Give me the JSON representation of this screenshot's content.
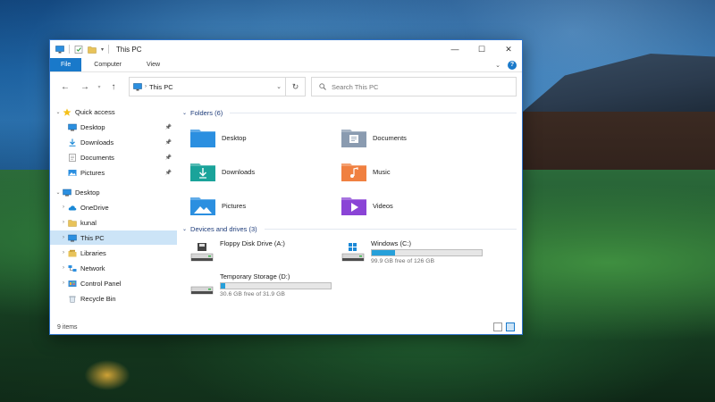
{
  "window": {
    "title": "This PC",
    "controls": {
      "minimize": "—",
      "maximize": "☐",
      "close": "✕"
    }
  },
  "ribbon": {
    "tabs": [
      "File",
      "Computer",
      "View"
    ],
    "help": "?"
  },
  "navigation": {
    "address": "This PC",
    "search_placeholder": "Search This PC"
  },
  "sidebar": {
    "items": [
      {
        "label": "Quick access",
        "icon": "star-icon",
        "level": 0,
        "expanded": true,
        "pinned": false
      },
      {
        "label": "Desktop",
        "icon": "desktop-icon",
        "level": 1,
        "pinned": true
      },
      {
        "label": "Downloads",
        "icon": "downloads-icon",
        "level": 1,
        "pinned": true
      },
      {
        "label": "Documents",
        "icon": "documents-icon",
        "level": 1,
        "pinned": true
      },
      {
        "label": "Pictures",
        "icon": "pictures-icon",
        "level": 1,
        "pinned": true
      },
      {
        "label": "Desktop",
        "icon": "desktop-icon",
        "level": 0,
        "expanded": true,
        "pinned": false
      },
      {
        "label": "OneDrive",
        "icon": "cloud-icon",
        "level": 1,
        "pinned": false
      },
      {
        "label": "kunal",
        "icon": "folder-icon",
        "level": 1,
        "pinned": false
      },
      {
        "label": "This PC",
        "icon": "computer-icon",
        "level": 1,
        "selected": true,
        "pinned": false
      },
      {
        "label": "Libraries",
        "icon": "libraries-icon",
        "level": 1,
        "pinned": false
      },
      {
        "label": "Network",
        "icon": "network-icon",
        "level": 1,
        "pinned": false
      },
      {
        "label": "Control Panel",
        "icon": "control-panel-icon",
        "level": 1,
        "pinned": false
      },
      {
        "label": "Recycle Bin",
        "icon": "recycle-bin-icon",
        "level": 1,
        "pinned": false
      }
    ]
  },
  "folders": {
    "header": "Folders (6)",
    "items": [
      {
        "label": "Desktop",
        "icon": "desktop-folder-icon",
        "color": "#2b8fe0"
      },
      {
        "label": "Documents",
        "icon": "documents-folder-icon",
        "color": "#8a9bb0"
      },
      {
        "label": "Downloads",
        "icon": "downloads-folder-icon",
        "color": "#1aa39a"
      },
      {
        "label": "Music",
        "icon": "music-folder-icon",
        "color": "#f08040"
      },
      {
        "label": "Pictures",
        "icon": "pictures-folder-icon",
        "color": "#2b8fe0"
      },
      {
        "label": "Videos",
        "icon": "videos-folder-icon",
        "color": "#8a44d6"
      }
    ]
  },
  "drives": {
    "header": "Devices and drives (3)",
    "items": [
      {
        "label": "Floppy Disk Drive (A:)",
        "icon": "floppy-drive-icon",
        "has_bar": false,
        "free": "",
        "used_fraction": 0
      },
      {
        "label": "Windows (C:)",
        "icon": "windows-drive-icon",
        "has_bar": true,
        "free": "99.9 GB free of 126 GB",
        "used_fraction": 0.21
      },
      {
        "label": "Temporary Storage (D:)",
        "icon": "hard-drive-icon",
        "has_bar": true,
        "free": "30.6 GB free of 31.9 GB",
        "used_fraction": 0.04
      }
    ]
  },
  "status": {
    "count": "9 items"
  },
  "colors": {
    "accent": "#1979ca",
    "selection": "#cce4f7",
    "drive_bar": "#26a0da",
    "header_text": "#1e3c7a"
  }
}
